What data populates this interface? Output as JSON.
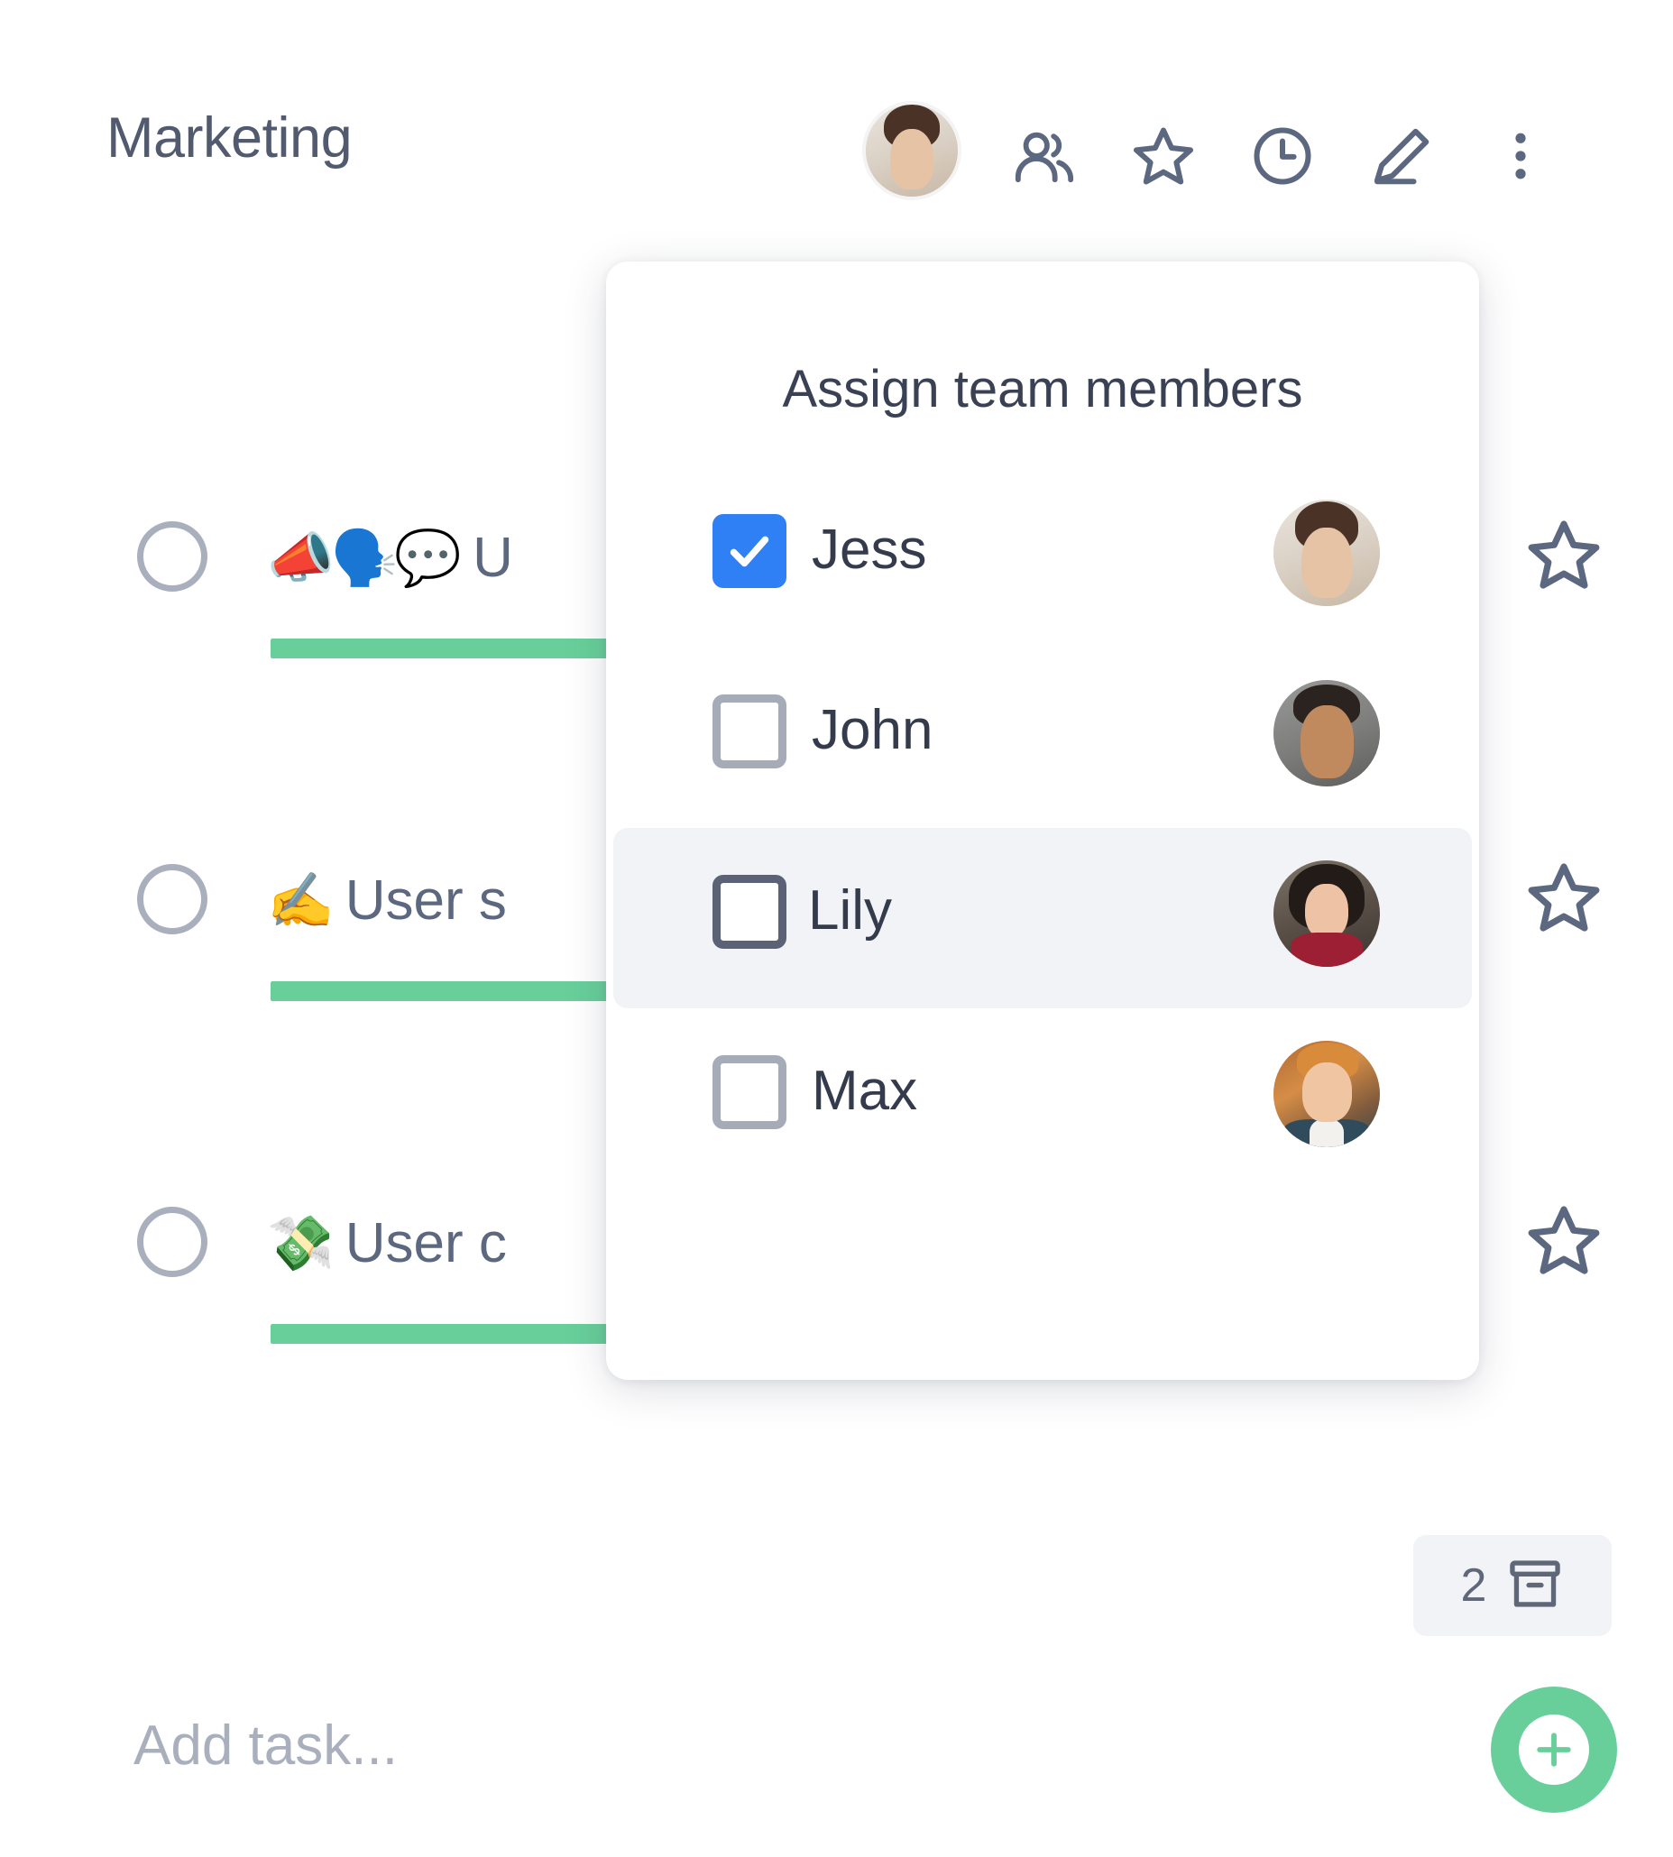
{
  "header": {
    "title": "Marketing",
    "avatar_person": "Jess",
    "actions": [
      {
        "name": "members-icon",
        "label": "Members"
      },
      {
        "name": "star-icon",
        "label": "Favorite"
      },
      {
        "name": "clock-icon",
        "label": "History"
      },
      {
        "name": "pencil-icon",
        "label": "Edit"
      },
      {
        "name": "more-vertical-icon",
        "label": "More options"
      }
    ]
  },
  "tasks": [
    {
      "emoji": "📣🗣️💬",
      "title": "U",
      "full_title_visible": "U",
      "progress": 100,
      "completed": false,
      "starred": false
    },
    {
      "emoji": "✍️",
      "title": "User s",
      "full_title_visible": "User s",
      "progress": 74,
      "completed": false,
      "starred": false
    },
    {
      "emoji": "💸",
      "title": "User c",
      "full_title_visible": "User c",
      "progress": 52,
      "completed": false,
      "starred": false
    }
  ],
  "archive": {
    "count": "2",
    "icon": "archive-box-icon"
  },
  "add_task": {
    "placeholder": "Add task...",
    "value": "",
    "button_icon": "plus-icon"
  },
  "assign_popup": {
    "title": "Assign team members",
    "members": [
      {
        "name": "Jess",
        "checked": true,
        "hovered": false,
        "avatar": "jess"
      },
      {
        "name": "John",
        "checked": false,
        "hovered": false,
        "avatar": "john"
      },
      {
        "name": "Lily",
        "checked": false,
        "hovered": true,
        "avatar": "lily"
      },
      {
        "name": "Max",
        "checked": false,
        "hovered": false,
        "avatar": "max"
      }
    ]
  },
  "colors": {
    "accent_green": "#68cf9a",
    "checkbox_blue": "#2f7ff5",
    "text_primary": "#343b4d",
    "text_muted": "#5c6780",
    "placeholder": "#a9afbd",
    "track_gray": "#e6e8eb",
    "hover_bg": "#f1f3f6",
    "badge_bg": "#f1f3f7"
  }
}
